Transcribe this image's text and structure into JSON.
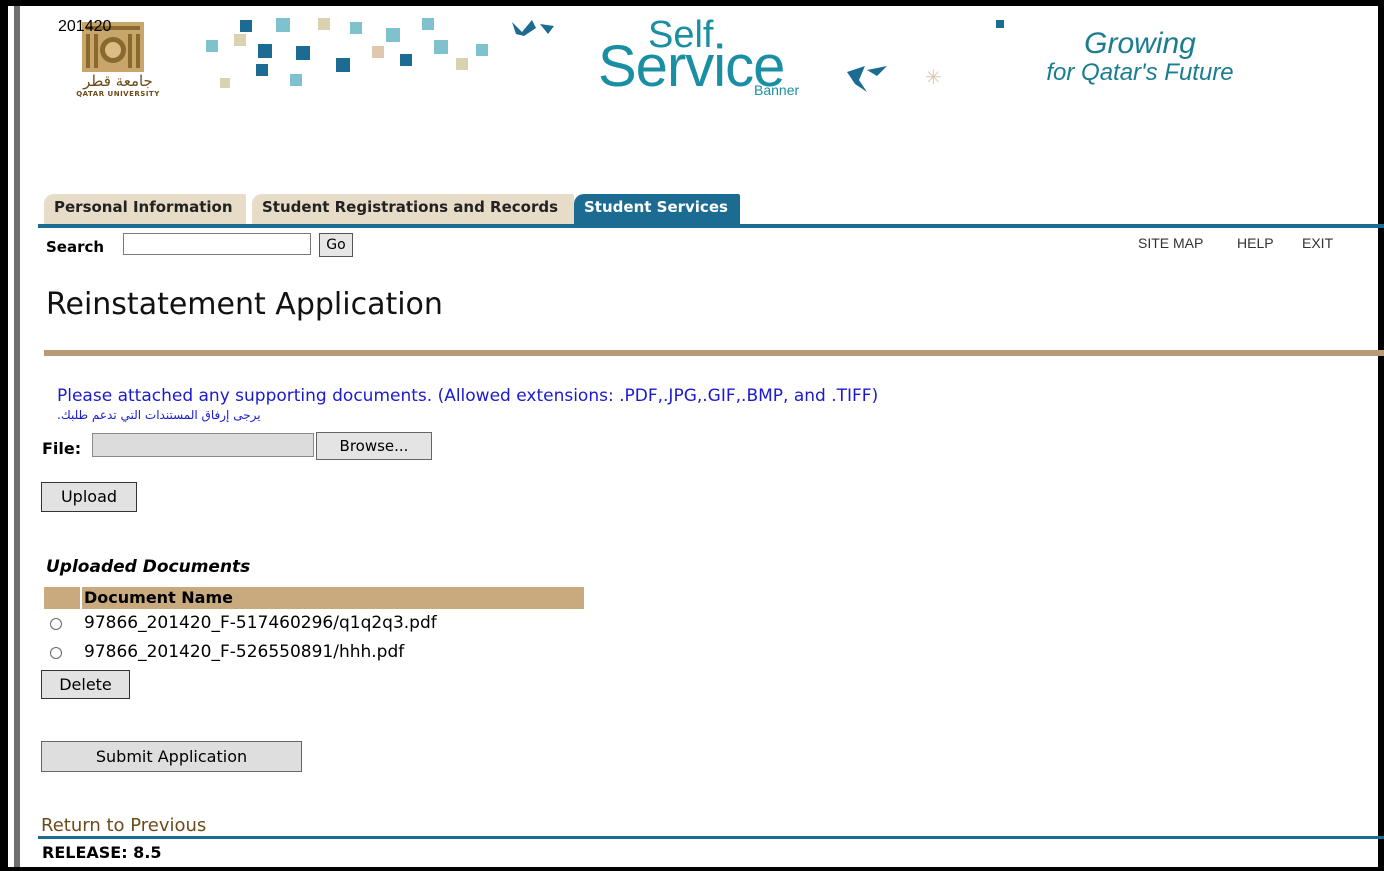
{
  "header": {
    "term": "201420",
    "university_ar": "جامعة قطر",
    "university_en": "QATAR UNIVERSITY",
    "product_self": "Self",
    "product_service": "Service",
    "product_banner": "Banner",
    "tagline_1": "Growing",
    "tagline_2": "for Qatar's Future",
    "accent_teal": "#1a8fa3",
    "accent_navy": "#1c6b93"
  },
  "tabs": [
    {
      "label": "Personal Information",
      "active": false
    },
    {
      "label": "Student Registrations and Records",
      "active": false
    },
    {
      "label": "Student Services",
      "active": true
    }
  ],
  "search": {
    "label": "Search",
    "value": "",
    "go_label": "Go"
  },
  "toplinks": {
    "site_map": "SITE MAP",
    "help": "HELP",
    "exit": "EXIT"
  },
  "page": {
    "title": "Reinstatement Application"
  },
  "upload": {
    "info_en": "Please attached any supporting documents. (Allowed extensions: .PDF,.JPG,.GIF,.BMP, and .TIFF)",
    "info_ar": ".يرجى إرفاق المستندات التي تدعم طلبك",
    "file_label": "File:",
    "browse_label": "Browse...",
    "upload_label": "Upload"
  },
  "documents": {
    "title": "Uploaded Documents",
    "column_header": "Document Name",
    "rows": [
      {
        "name": "97866_201420_F-517460296/q1q2q3.pdf"
      },
      {
        "name": "97866_201420_F-526550891/hhh.pdf"
      }
    ],
    "delete_label": "Delete"
  },
  "actions": {
    "submit_label": "Submit Application"
  },
  "footer": {
    "return_label": "Return to Previous",
    "release": "RELEASE: 8.5"
  }
}
